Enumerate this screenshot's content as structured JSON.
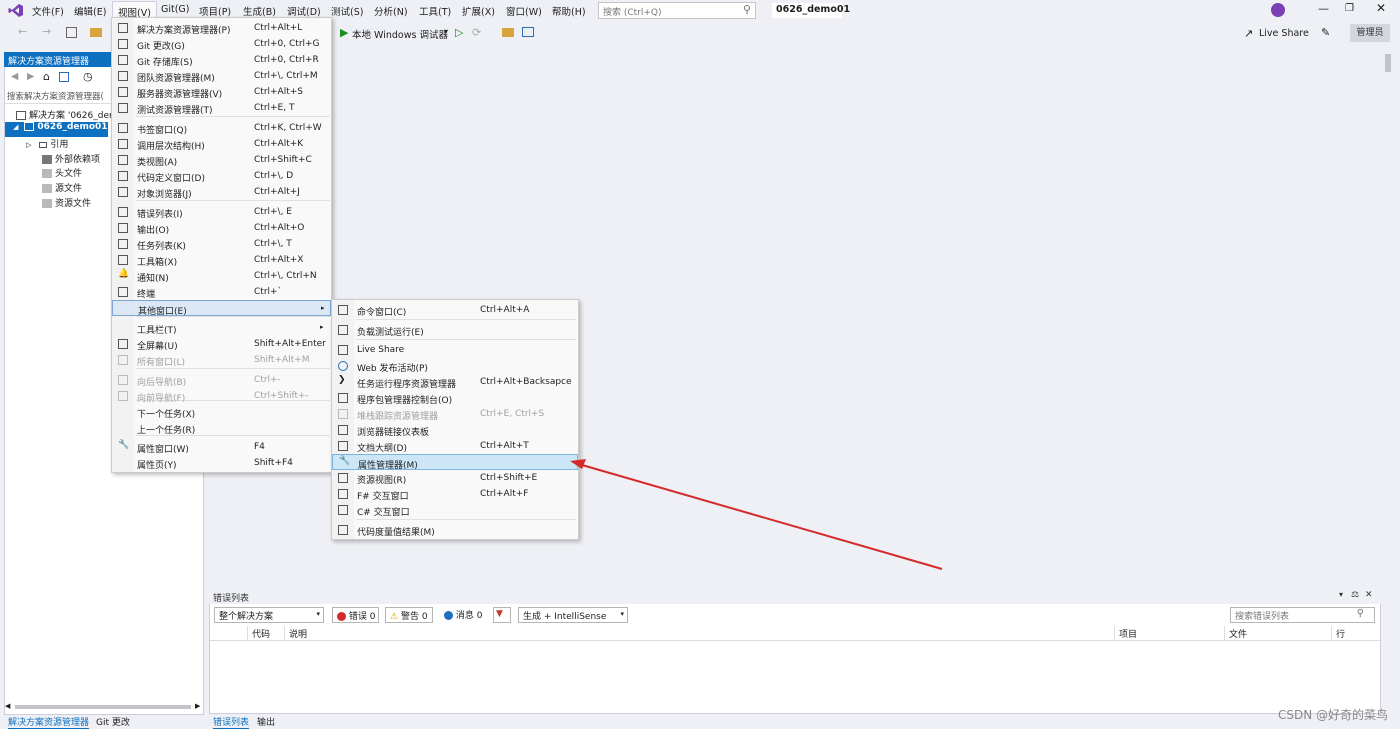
{
  "menubar": {
    "items": [
      "文件(F)",
      "编辑(E)",
      "视图(V)",
      "Git(G)",
      "项目(P)",
      "生成(B)",
      "调试(D)",
      "测试(S)",
      "分析(N)",
      "工具(T)",
      "扩展(X)",
      "窗口(W)",
      "帮助(H)"
    ],
    "search_placeholder": "搜索 (Ctrl+Q)",
    "project_name": "0626_demo01"
  },
  "toolbar": {
    "debug_target": "本地 Windows 调试器",
    "live_share": "Live Share",
    "admin": "管理员"
  },
  "solution_explorer": {
    "title": "解决方案资源管理器",
    "search_placeholder": "搜索解决方案资源管理器(",
    "tree": [
      {
        "label": "解决方案 '0626_dem",
        "selected": false
      },
      {
        "label": "0626_demo01",
        "selected": true
      },
      {
        "label": "引用",
        "selected": false
      },
      {
        "label": "外部依赖项",
        "selected": false
      },
      {
        "label": "头文件",
        "selected": false
      },
      {
        "label": "源文件",
        "selected": false
      },
      {
        "label": "资源文件",
        "selected": false
      }
    ]
  },
  "view_menu": {
    "items": [
      {
        "label": "解决方案资源管理器(P)",
        "key": "Ctrl+Alt+L",
        "icon": "solution-explorer-icon"
      },
      {
        "label": "Git 更改(G)",
        "key": "Ctrl+0, Ctrl+G",
        "icon": "git-changes-icon"
      },
      {
        "label": "Git 存储库(S)",
        "key": "Ctrl+0, Ctrl+R",
        "icon": "git-repo-icon"
      },
      {
        "label": "团队资源管理器(M)",
        "key": "Ctrl+\\, Ctrl+M",
        "icon": "team-explorer-icon"
      },
      {
        "label": "服务器资源管理器(V)",
        "key": "Ctrl+Alt+S",
        "icon": "server-explorer-icon"
      },
      {
        "label": "测试资源管理器(T)",
        "key": "Ctrl+E, T",
        "icon": "test-explorer-icon"
      },
      {
        "label": "书签窗口(Q)",
        "key": "Ctrl+K, Ctrl+W",
        "icon": "bookmark-icon"
      },
      {
        "label": "调用层次结构(H)",
        "key": "Ctrl+Alt+K",
        "icon": "call-hierarchy-icon"
      },
      {
        "label": "类视图(A)",
        "key": "Ctrl+Shift+C",
        "icon": "class-view-icon"
      },
      {
        "label": "代码定义窗口(D)",
        "key": "Ctrl+\\, D",
        "icon": "code-definition-icon"
      },
      {
        "label": "对象浏览器(J)",
        "key": "Ctrl+Alt+J",
        "icon": "object-browser-icon"
      },
      {
        "label": "错误列表(I)",
        "key": "Ctrl+\\, E",
        "icon": "error-list-icon"
      },
      {
        "label": "输出(O)",
        "key": "Ctrl+Alt+O",
        "icon": "output-icon"
      },
      {
        "label": "任务列表(K)",
        "key": "Ctrl+\\, T",
        "icon": "task-list-icon"
      },
      {
        "label": "工具箱(X)",
        "key": "Ctrl+Alt+X",
        "icon": "toolbox-icon"
      },
      {
        "label": "通知(N)",
        "key": "Ctrl+\\, Ctrl+N",
        "icon": "bell-icon"
      },
      {
        "label": "终端",
        "key": "Ctrl+`",
        "icon": "terminal-icon"
      },
      {
        "label": "其他窗口(E)",
        "key": "",
        "icon": ""
      },
      {
        "label": "工具栏(T)",
        "key": "",
        "icon": ""
      },
      {
        "label": "全屏幕(U)",
        "key": "Shift+Alt+Enter",
        "icon": "fullscreen-icon"
      },
      {
        "label": "所有窗口(L)",
        "key": "Shift+Alt+M",
        "icon": "all-windows-icon"
      },
      {
        "label": "向后导航(B)",
        "key": "Ctrl+-",
        "icon": "nav-back-icon"
      },
      {
        "label": "向前导航(F)",
        "key": "Ctrl+Shift+-",
        "icon": "nav-forward-icon"
      },
      {
        "label": "下一个任务(X)",
        "key": "",
        "icon": ""
      },
      {
        "label": "上一个任务(R)",
        "key": "",
        "icon": ""
      },
      {
        "label": "属性窗口(W)",
        "key": "F4",
        "icon": "wrench-icon"
      },
      {
        "label": "属性页(Y)",
        "key": "Shift+F4",
        "icon": ""
      }
    ]
  },
  "other_windows_menu": {
    "items": [
      {
        "label": "命令窗口(C)",
        "key": "Ctrl+Alt+A",
        "icon": "command-window-icon"
      },
      {
        "label": "负载测试运行(E)",
        "key": "",
        "icon": "load-test-icon"
      },
      {
        "label": "Live Share",
        "key": "",
        "icon": "live-share-icon"
      },
      {
        "label": "Web 发布活动(P)",
        "key": "",
        "icon": "globe-icon"
      },
      {
        "label": "任务运行程序资源管理器",
        "key": "Ctrl+Alt+Backsapce",
        "icon": "chevron-right-icon"
      },
      {
        "label": "程序包管理器控制台(O)",
        "key": "",
        "icon": "package-console-icon"
      },
      {
        "label": "堆栈跟踪资源管理器",
        "key": "Ctrl+E, Ctrl+S",
        "icon": "stack-trace-icon"
      },
      {
        "label": "浏览器链接仪表板",
        "key": "",
        "icon": "browser-link-icon"
      },
      {
        "label": "文档大纲(D)",
        "key": "Ctrl+Alt+T",
        "icon": "document-outline-icon"
      },
      {
        "label": "属性管理器(M)",
        "key": "",
        "icon": "wrench-icon"
      },
      {
        "label": "资源视图(R)",
        "key": "Ctrl+Shift+E",
        "icon": "resource-view-icon"
      },
      {
        "label": "F# 交互窗口",
        "key": "Ctrl+Alt+F",
        "icon": "fsharp-icon"
      },
      {
        "label": "C# 交互窗口",
        "key": "",
        "icon": "csharp-icon"
      },
      {
        "label": "代码度量值结果(M)",
        "key": "",
        "icon": "code-metrics-icon"
      }
    ]
  },
  "error_list": {
    "title": "错误列表",
    "scope": "整个解决方案",
    "errors": "错误 0",
    "warnings": "警告 0",
    "messages": "消息 0",
    "build_filter": "生成 + IntelliSense",
    "search_placeholder": "搜索错误列表",
    "columns": [
      "代码",
      "说明",
      "项目",
      "文件",
      "行"
    ]
  },
  "bottom_tabs": {
    "left": [
      "解决方案资源管理器",
      "Git 更改"
    ],
    "main": [
      "错误列表",
      "输出"
    ]
  },
  "watermark": "CSDN @好奇的菜鸟",
  "colors": {
    "accent": "#0e70c0",
    "arrow": "#d42a2a",
    "highlight": "#cde6f7"
  }
}
